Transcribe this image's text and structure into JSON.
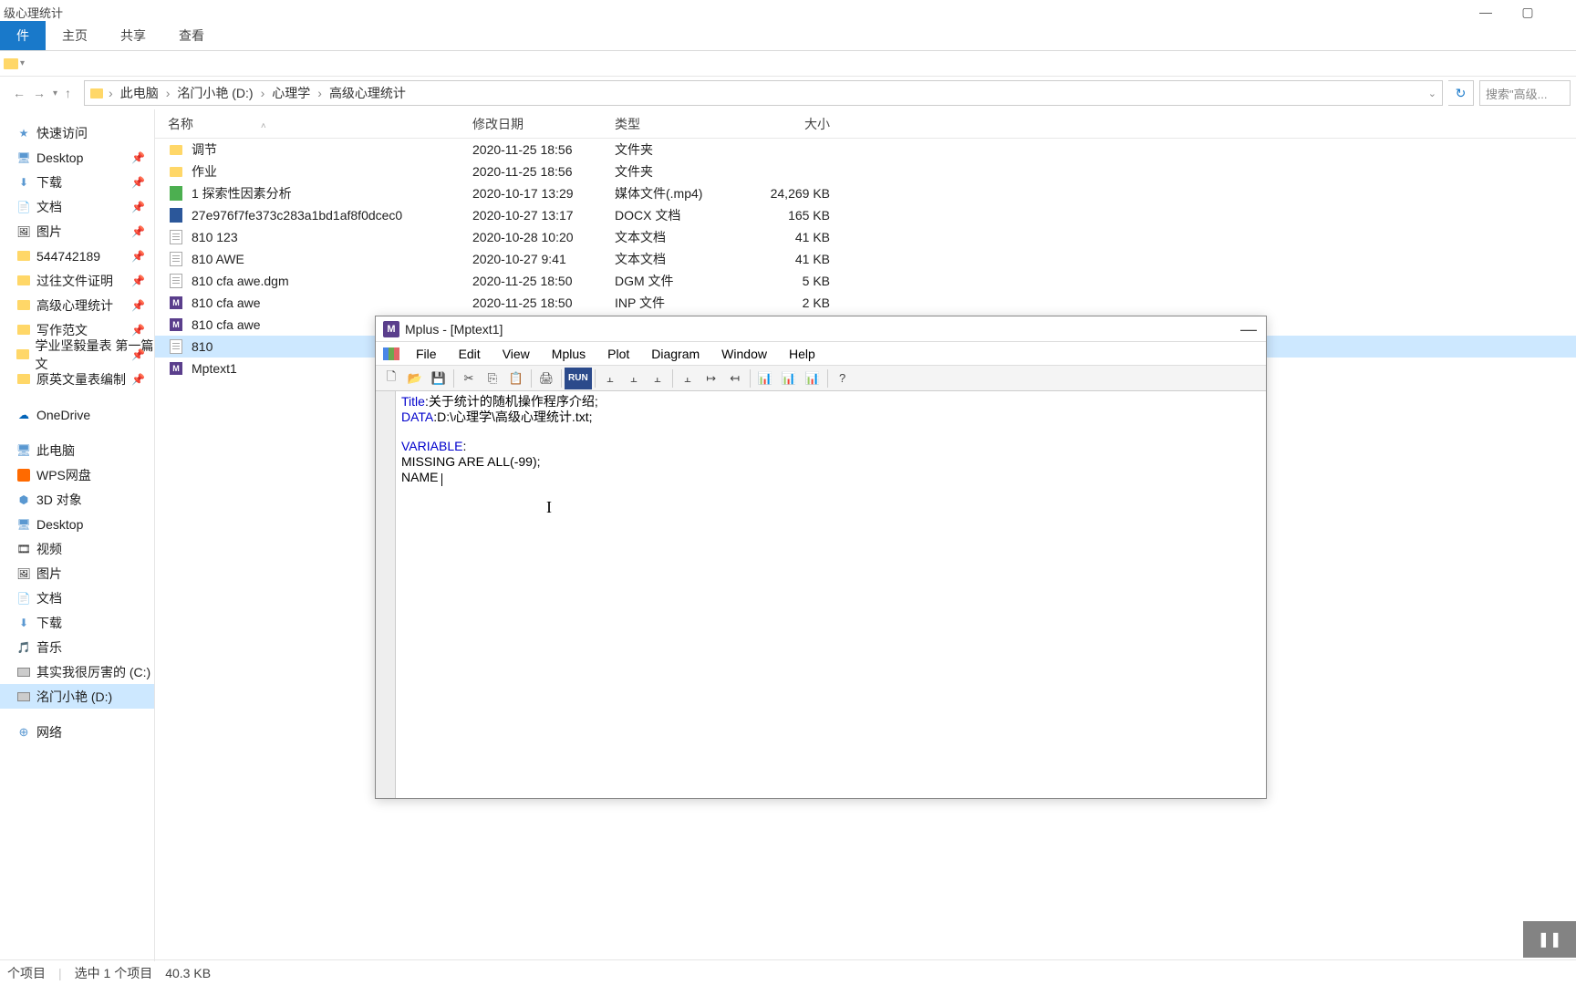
{
  "explorer": {
    "title": "级心理统计",
    "ribbon": {
      "file": "件",
      "home": "主页",
      "share": "共享",
      "view": "查看"
    },
    "breadcrumb": {
      "root_icon": "pc",
      "parts": [
        "此电脑",
        "洺门小艳 (D:)",
        "心理学",
        "高级心理统计"
      ]
    },
    "search_placeholder": "搜索\"高级...",
    "columns": {
      "name": "名称",
      "date": "修改日期",
      "type": "类型",
      "size": "大小"
    },
    "sidebar": {
      "quick": "快速访问",
      "items_pinned": [
        {
          "label": "Desktop",
          "icon": "desktop"
        },
        {
          "label": "下载",
          "icon": "down"
        },
        {
          "label": "文档",
          "icon": "doc"
        },
        {
          "label": "图片",
          "icon": "pic"
        },
        {
          "label": "544742189",
          "icon": "folder"
        },
        {
          "label": "过往文件证明",
          "icon": "folder"
        },
        {
          "label": "高级心理统计",
          "icon": "folder"
        },
        {
          "label": "写作范文",
          "icon": "folder"
        },
        {
          "label": "学业坚毅量表 第一篇文",
          "icon": "folder"
        },
        {
          "label": "原英文量表编制",
          "icon": "folder"
        }
      ],
      "onedrive": "OneDrive",
      "thispc": "此电脑",
      "wps": "WPS网盘",
      "pc_items": [
        {
          "label": "3D 对象",
          "icon": "3d"
        },
        {
          "label": "Desktop",
          "icon": "desktop"
        },
        {
          "label": "视频",
          "icon": "video"
        },
        {
          "label": "图片",
          "icon": "pic"
        },
        {
          "label": "文档",
          "icon": "doc"
        },
        {
          "label": "下载",
          "icon": "down"
        },
        {
          "label": "音乐",
          "icon": "music"
        },
        {
          "label": "其实我很厉害的 (C:)",
          "icon": "hd"
        },
        {
          "label": "洺门小艳 (D:)",
          "icon": "hd",
          "selected": true
        }
      ],
      "network": "网络"
    },
    "files": [
      {
        "name": "调节",
        "date": "2020-11-25 18:56",
        "type": "文件夹",
        "size": "",
        "icon": "folder"
      },
      {
        "name": "作业",
        "date": "2020-11-25 18:56",
        "type": "文件夹",
        "size": "",
        "icon": "folder"
      },
      {
        "name": "1 探索性因素分析",
        "date": "2020-10-17 13:29",
        "type": "媒体文件(.mp4)",
        "size": "24,269 KB",
        "icon": "mp4"
      },
      {
        "name": "27e976f7fe373c283a1bd1af8f0dcec0",
        "date": "2020-10-27 13:17",
        "type": "DOCX 文档",
        "size": "165 KB",
        "icon": "word"
      },
      {
        "name": "810 123",
        "date": "2020-10-28 10:20",
        "type": "文本文档",
        "size": "41 KB",
        "icon": "txt"
      },
      {
        "name": "810 AWE",
        "date": "2020-10-27 9:41",
        "type": "文本文档",
        "size": "41 KB",
        "icon": "txt"
      },
      {
        "name": "810 cfa awe.dgm",
        "date": "2020-11-25 18:50",
        "type": "DGM 文件",
        "size": "5 KB",
        "icon": "txt"
      },
      {
        "name": "810 cfa awe",
        "date": "2020-11-25 18:50",
        "type": "INP 文件",
        "size": "2 KB",
        "icon": "mplus"
      },
      {
        "name": "810 cfa awe",
        "date": "",
        "type": "",
        "size": "",
        "icon": "mplus"
      },
      {
        "name": "810",
        "date": "",
        "type": "",
        "size": "",
        "icon": "txt",
        "selected": true
      },
      {
        "name": "Mptext1",
        "date": "",
        "type": "",
        "size": "",
        "icon": "mplus"
      }
    ],
    "status": {
      "items": "个项目",
      "selected": "选中 1 个项目",
      "size": "40.3 KB"
    }
  },
  "mplus": {
    "title": "Mplus - [Mptext1]",
    "menu": [
      "File",
      "Edit",
      "View",
      "Mplus",
      "Plot",
      "Diagram",
      "Window",
      "Help"
    ],
    "toolbar": {
      "new": "new",
      "open": "open",
      "save": "save",
      "cut": "cut",
      "copy": "copy",
      "paste": "paste",
      "print": "print",
      "run": "RUN",
      "help": "?"
    },
    "code": {
      "l1_kw": "Title",
      "l1_rest": ":关于统计的随机操作程序介绍;",
      "l2_kw": "DATA",
      "l2_rest": ":D:\\心理学\\高级心理统计.txt;",
      "l4_kw": "VARIABLE",
      "l4_rest": ":",
      "l5": "MISSING ARE ALL(-99);",
      "l6": "NAME "
    }
  }
}
